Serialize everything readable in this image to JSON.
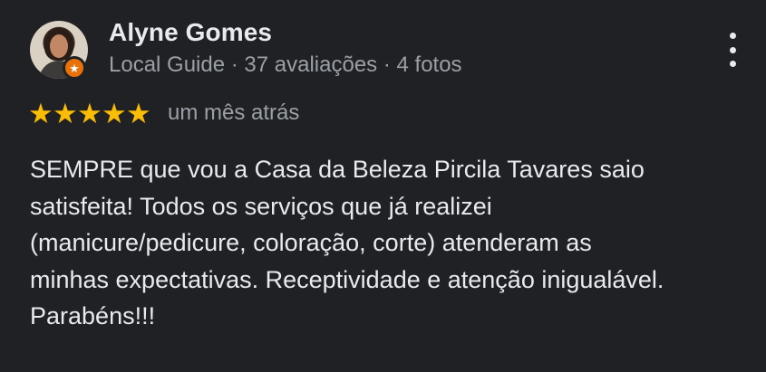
{
  "author": {
    "name": "Alyne Gomes",
    "meta": "Local Guide · 37 avaliações · 4 fotos",
    "badge_icon": "star-icon",
    "badge_color": "#e8710a"
  },
  "review": {
    "rating": 5,
    "max_rating": 5,
    "star_color": "#fbbc04",
    "time_ago": "um mês atrás",
    "text": "SEMPRE que vou a Casa da Beleza Pircila Tavares saio\nsatisfeita! Todos os serviços que já realizei\n(manicure/pedicure, coloração, corte) atenderam as\nminhas expectativas. Receptividade e atenção inigualável.\nParabéns!!!"
  },
  "actions": {
    "more_icon": "more-vertical-icon"
  },
  "theme": {
    "background": "#202124",
    "primary_text": "#e8eaed",
    "secondary_text": "#9aa0a6"
  }
}
